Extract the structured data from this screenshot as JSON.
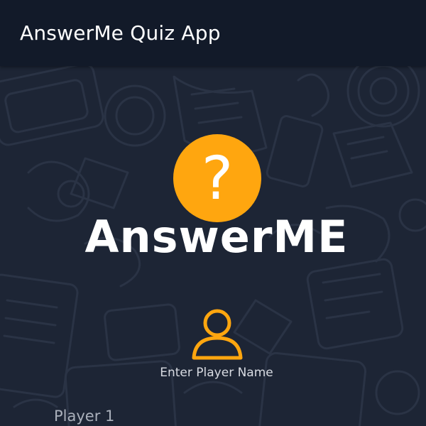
{
  "app_bar": {
    "title": "AnswerMe Quiz App"
  },
  "logo": {
    "badge_glyph": "?",
    "wordmark": "AnswerME",
    "badge_color": "#ffa60f"
  },
  "player": {
    "icon": "person-icon",
    "icon_color": "#ffa60f",
    "prompt": "Enter Player Name",
    "name_field": {
      "placeholder": "Player 1"
    }
  },
  "colors": {
    "background": "#1d2535",
    "app_bar": "#121a29",
    "accent": "#ffa60f",
    "text": "#ffffff"
  }
}
